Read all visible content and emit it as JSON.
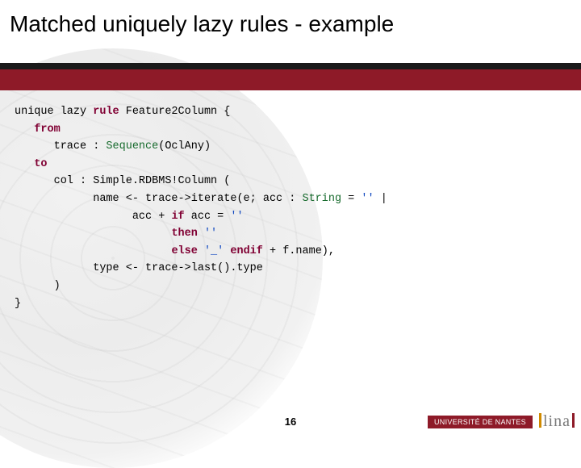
{
  "title": "Matched uniquely lazy rules - example",
  "page_number": "16",
  "footer": {
    "university": "UNIVERSITÉ DE NANTES",
    "lab": "lina"
  },
  "code": {
    "l1a": "unique lazy ",
    "l1b": "rule",
    "l1c": " Feature2Column {",
    "l2a": "   ",
    "l2b": "from",
    "l3a": "      trace : ",
    "l3b": "Sequence",
    "l3c": "(OclAny)",
    "l4a": "   ",
    "l4b": "to",
    "l5": "      col : Simple.RDBMS!Column (",
    "l6a": "            name <- trace->iterate(e; acc : ",
    "l6b": "String",
    "l6c": " = ",
    "l6d": "''",
    "l6e": " |",
    "l7a": "                  acc + ",
    "l7b": "if",
    "l7c": " acc = ",
    "l7d": "''",
    "l8a": "                        ",
    "l8b": "then",
    "l8c": " ",
    "l8d": "''",
    "l9a": "                        ",
    "l9b": "else",
    "l9c": " ",
    "l9d": "'_'",
    "l9e": " ",
    "l9f": "endif",
    "l9g": " + f.name),",
    "l10": "            type <- trace->last().type",
    "l11": "      )",
    "l12": "}"
  }
}
